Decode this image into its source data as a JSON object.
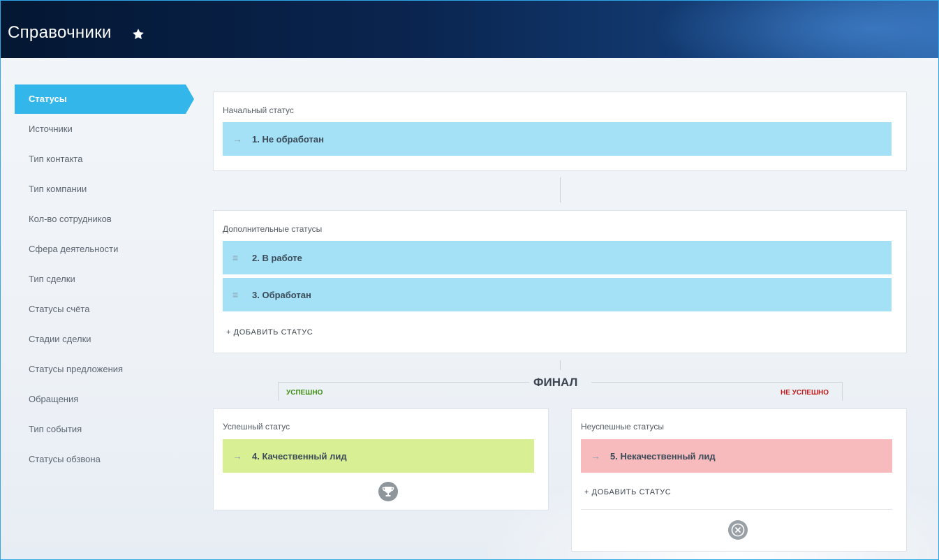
{
  "header": {
    "title": "Справочники",
    "star_icon": "star-icon"
  },
  "sidebar": {
    "items": [
      {
        "label": "Статусы",
        "active": true
      },
      {
        "label": "Источники"
      },
      {
        "label": "Тип контакта"
      },
      {
        "label": "Тип компании"
      },
      {
        "label": "Кол-во сотрудников"
      },
      {
        "label": "Сфера деятельности"
      },
      {
        "label": "Тип сделки"
      },
      {
        "label": "Статусы счёта"
      },
      {
        "label": "Стадии сделки"
      },
      {
        "label": "Статусы предложения"
      },
      {
        "label": "Обращения"
      },
      {
        "label": "Тип события"
      },
      {
        "label": "Статусы обзвона"
      }
    ]
  },
  "initial": {
    "label": "Начальный статус",
    "status": "1. Не обработан",
    "icon": "arrow-right-icon"
  },
  "additional": {
    "label": "Дополнительные статусы",
    "statuses": [
      {
        "name": "2. В работе",
        "icon": "drag-handle-icon"
      },
      {
        "name": "3. Обработан",
        "icon": "drag-handle-icon"
      }
    ],
    "add_label": "+ ДОБАВИТЬ СТАТУС"
  },
  "final": {
    "title": "ФИНАЛ",
    "success_label": "УСПЕШНО",
    "fail_label": "НЕ УСПЕШНО"
  },
  "success": {
    "label": "Успешный статус",
    "status": "4. Качественный лид",
    "icon": "trophy-icon"
  },
  "failure": {
    "label": "Неуспешные статусы",
    "status": "5. Некачественный лид",
    "add_label": "+ ДОБАВИТЬ СТАТУС",
    "icon": "close-circle-icon"
  },
  "colors": {
    "accent": "#33b7ea",
    "status_blue": "#a4e1f7",
    "status_green": "#d9ef94",
    "status_red": "#f7bbbd",
    "success_text": "#3f8c12",
    "fail_text": "#c01a1a"
  }
}
